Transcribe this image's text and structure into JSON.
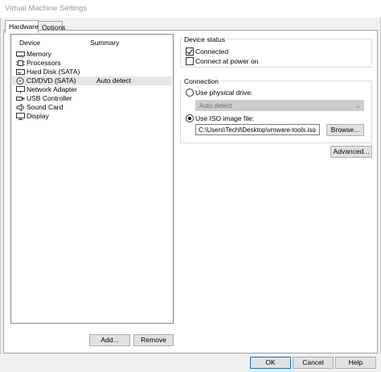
{
  "window": {
    "title": "Virtual Machine Settings"
  },
  "tabs": [
    {
      "label": "Hardware",
      "active": true
    },
    {
      "label": "Options",
      "active": false
    }
  ],
  "device_list": {
    "headers": {
      "device": "Device",
      "summary": "Summary"
    },
    "items": [
      {
        "name": "Memory",
        "summary": "",
        "icon": "memory-icon",
        "selected": false
      },
      {
        "name": "Processors",
        "summary": "",
        "icon": "processor-icon",
        "selected": false
      },
      {
        "name": "Hard Disk (SATA)",
        "summary": "",
        "icon": "hard-disk-icon",
        "selected": false
      },
      {
        "name": "CD/DVD (SATA)",
        "summary": "Auto detect",
        "icon": "cd-dvd-icon",
        "selected": true
      },
      {
        "name": "Network Adapter",
        "summary": "",
        "icon": "network-adapter-icon",
        "selected": false
      },
      {
        "name": "USB Controller",
        "summary": "",
        "icon": "usb-icon",
        "selected": false
      },
      {
        "name": "Sound Card",
        "summary": "",
        "icon": "sound-card-icon",
        "selected": false
      },
      {
        "name": "Display",
        "summary": "",
        "icon": "display-icon",
        "selected": false
      }
    ],
    "add_label": "Add...",
    "remove_label": "Remove"
  },
  "device_status": {
    "label": "Device status",
    "connected": {
      "label": "Connected",
      "checked": true
    },
    "connect_at_power_on": {
      "label": "Connect at power on",
      "checked": false
    }
  },
  "connection": {
    "label": "Connection",
    "use_physical_drive": {
      "label": "Use physical drive:",
      "selected": false
    },
    "physical_drive_value": "Auto detect",
    "use_iso": {
      "label": "Use ISO image file:",
      "selected": true
    },
    "iso_path": "C:\\Users\\Techl\\Desktop\\vmware-tools.iso",
    "browse_label": "Browse..."
  },
  "advanced_label": "Advanced...",
  "footer": {
    "ok_label": "OK",
    "cancel_label": "Cancel",
    "help_label": "Help"
  }
}
